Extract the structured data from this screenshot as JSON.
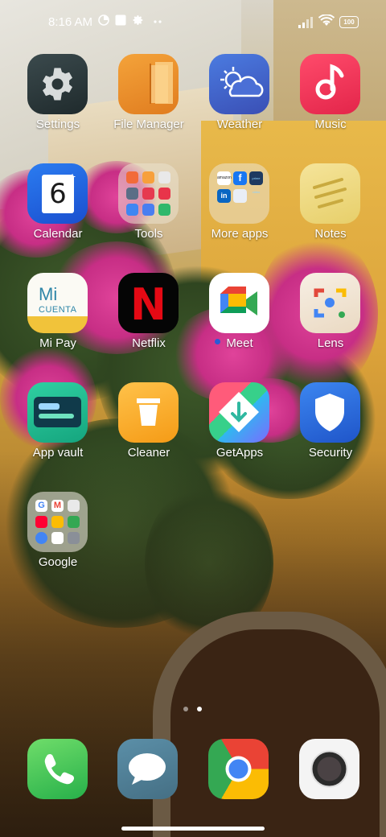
{
  "status_bar": {
    "time": "8:16 AM",
    "battery": "100"
  },
  "apps": [
    {
      "label": "Settings"
    },
    {
      "label": "File Manager"
    },
    {
      "label": "Weather"
    },
    {
      "label": "Music"
    },
    {
      "label": "Calendar",
      "icon_text": "6"
    },
    {
      "label": "Tools"
    },
    {
      "label": "More apps"
    },
    {
      "label": "Notes"
    },
    {
      "label": "Mi Pay",
      "icon_text_1": "Mi",
      "icon_text_2": "CUENTA"
    },
    {
      "label": "Netflix",
      "icon_text": "N"
    },
    {
      "label": "Meet"
    },
    {
      "label": "Lens"
    },
    {
      "label": "App vault"
    },
    {
      "label": "Cleaner"
    },
    {
      "label": "GetApps"
    },
    {
      "label": "Security"
    },
    {
      "label": "Google"
    }
  ],
  "more_apps_tiles": [
    "amazon",
    "prime video"
  ],
  "dock": [
    "Phone",
    "Messages",
    "Chrome",
    "Camera"
  ],
  "page_indicator": {
    "pages": 2,
    "current": 2
  },
  "colors": {
    "accent_blue": "#2a5bd7",
    "netflix_red": "#e50914"
  }
}
